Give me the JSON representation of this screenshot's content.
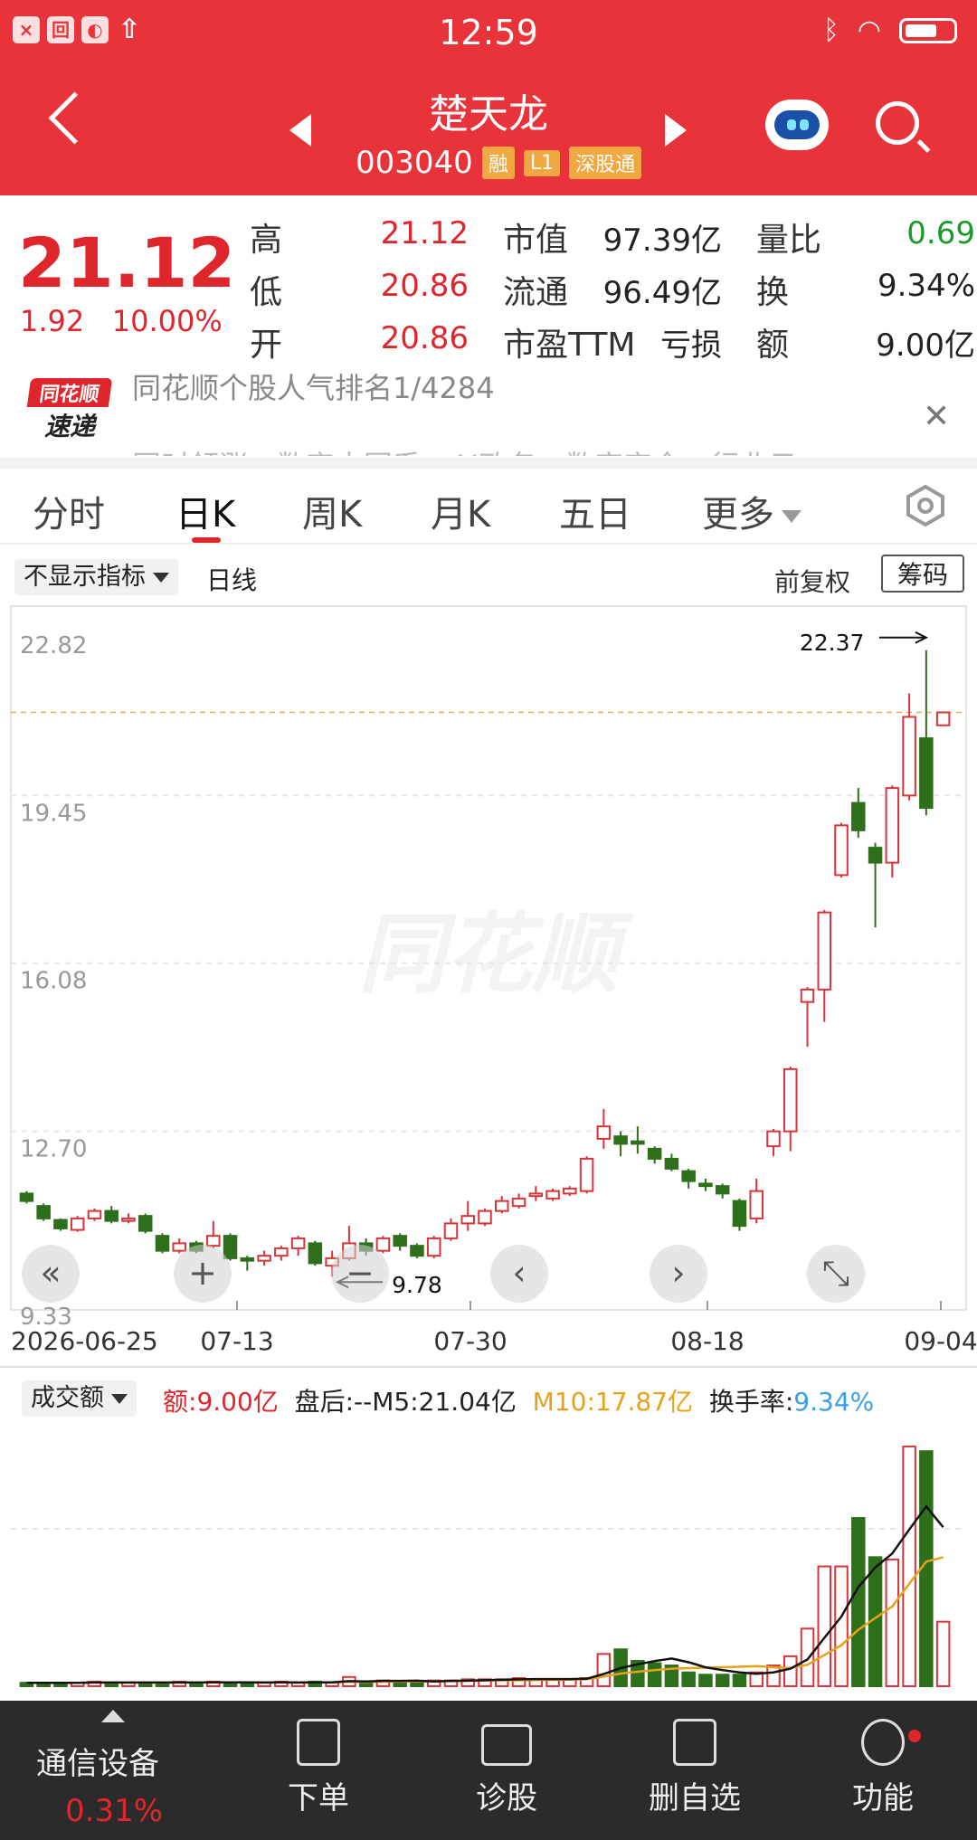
{
  "status_bar": {
    "time": "12:59"
  },
  "header": {
    "stock_name": "楚天龙",
    "code": "003040",
    "tags": [
      "融",
      "L1",
      "深股通"
    ]
  },
  "quote": {
    "price": "21.12",
    "change": "1.92",
    "change_pct": "10.00%",
    "rows": [
      [
        {
          "label": "高",
          "value": "21.12",
          "color": "red"
        },
        {
          "label": "市值",
          "value": "97.39亿",
          "color": "dark"
        },
        {
          "label": "量比",
          "value": "0.69",
          "color": "green"
        }
      ],
      [
        {
          "label": "低",
          "value": "20.86",
          "color": "red"
        },
        {
          "label": "流通",
          "value": "96.49亿",
          "color": "dark"
        },
        {
          "label": "换",
          "value": "9.34%",
          "color": "dark"
        }
      ],
      [
        {
          "label": "开",
          "value": "20.86",
          "color": "red"
        },
        {
          "label": "市盈TTM",
          "value": "亏损",
          "color": "dark"
        },
        {
          "label": "额",
          "value": "9.00亿",
          "color": "dark"
        }
      ]
    ]
  },
  "banner": {
    "logo_top": "同花顺",
    "logo_bottom": "速递",
    "line1": "同花顺个股人气排名1/4284",
    "line2": "同时领涨：数字中国系、AI政务、数字安全、行业云"
  },
  "tabs": [
    "分时",
    "日K",
    "周K",
    "月K",
    "五日",
    "更多"
  ],
  "active_tab": "日K",
  "indicator_bar": {
    "indicator": "不显示指标",
    "period": "日线",
    "adjust": "前复权",
    "chips": "筹码"
  },
  "chart_data": {
    "type": "candlestick",
    "y_ticks": [
      "22.82",
      "19.45",
      "16.08",
      "12.70",
      "9.33"
    ],
    "ylim": [
      9.33,
      22.82
    ],
    "x_ticks": [
      "2026-06-25",
      "07-13",
      "07-30",
      "08-18",
      "09-04"
    ],
    "high_label": "22.37",
    "low_label": "9.78",
    "current_price": 21.12,
    "candles": [
      {
        "o": 11.45,
        "c": 11.3,
        "h": 11.5,
        "l": 11.25
      },
      {
        "o": 11.2,
        "c": 10.95,
        "h": 11.25,
        "l": 10.9
      },
      {
        "o": 10.92,
        "c": 10.75,
        "h": 10.95,
        "l": 10.7
      },
      {
        "o": 10.72,
        "c": 10.95,
        "h": 11.0,
        "l": 10.68
      },
      {
        "o": 10.95,
        "c": 11.1,
        "h": 11.15,
        "l": 10.9
      },
      {
        "o": 11.1,
        "c": 10.9,
        "h": 11.2,
        "l": 10.85
      },
      {
        "o": 10.9,
        "c": 10.95,
        "h": 11.05,
        "l": 10.85
      },
      {
        "o": 11.0,
        "c": 10.7,
        "h": 11.05,
        "l": 10.65
      },
      {
        "o": 10.6,
        "c": 10.3,
        "h": 10.65,
        "l": 10.25
      },
      {
        "o": 10.3,
        "c": 10.45,
        "h": 10.55,
        "l": 10.25
      },
      {
        "o": 10.45,
        "c": 10.3,
        "h": 10.5,
        "l": 10.25
      },
      {
        "o": 10.4,
        "c": 10.6,
        "h": 10.9,
        "l": 10.35
      },
      {
        "o": 10.6,
        "c": 10.15,
        "h": 10.65,
        "l": 10.1
      },
      {
        "o": 10.15,
        "c": 10.1,
        "h": 10.2,
        "l": 9.9
      },
      {
        "o": 10.1,
        "c": 10.2,
        "h": 10.3,
        "l": 10.0
      },
      {
        "o": 10.2,
        "c": 10.35,
        "h": 10.4,
        "l": 10.1
      },
      {
        "o": 10.35,
        "c": 10.55,
        "h": 10.6,
        "l": 10.2
      },
      {
        "o": 10.45,
        "c": 10.05,
        "h": 10.5,
        "l": 10.0
      },
      {
        "o": 10.0,
        "c": 10.15,
        "h": 10.3,
        "l": 9.78
      },
      {
        "o": 10.15,
        "c": 10.45,
        "h": 10.8,
        "l": 10.1
      },
      {
        "o": 10.45,
        "c": 10.3,
        "h": 10.55,
        "l": 10.2
      },
      {
        "o": 10.3,
        "c": 10.55,
        "h": 10.6,
        "l": 10.25
      },
      {
        "o": 10.6,
        "c": 10.4,
        "h": 10.65,
        "l": 10.3
      },
      {
        "o": 10.4,
        "c": 10.2,
        "h": 10.45,
        "l": 10.15
      },
      {
        "o": 10.2,
        "c": 10.55,
        "h": 10.6,
        "l": 10.15
      },
      {
        "o": 10.55,
        "c": 10.85,
        "h": 10.95,
        "l": 10.5
      },
      {
        "o": 10.85,
        "c": 11.0,
        "h": 11.3,
        "l": 10.7
      },
      {
        "o": 10.85,
        "c": 11.1,
        "h": 11.15,
        "l": 10.8
      },
      {
        "o": 11.1,
        "c": 11.3,
        "h": 11.4,
        "l": 11.05
      },
      {
        "o": 11.2,
        "c": 11.35,
        "h": 11.45,
        "l": 11.15
      },
      {
        "o": 11.4,
        "c": 11.45,
        "h": 11.6,
        "l": 11.3
      },
      {
        "o": 11.35,
        "c": 11.5,
        "h": 11.55,
        "l": 11.3
      },
      {
        "o": 11.45,
        "c": 11.55,
        "h": 11.6,
        "l": 11.4
      },
      {
        "o": 11.5,
        "c": 12.15,
        "h": 12.2,
        "l": 11.45
      },
      {
        "o": 12.55,
        "c": 12.8,
        "h": 13.15,
        "l": 12.35
      },
      {
        "o": 12.6,
        "c": 12.45,
        "h": 12.7,
        "l": 12.2
      },
      {
        "o": 12.5,
        "c": 12.45,
        "h": 12.8,
        "l": 12.25
      },
      {
        "o": 12.35,
        "c": 12.15,
        "h": 12.4,
        "l": 12.05
      },
      {
        "o": 12.15,
        "c": 11.95,
        "h": 12.25,
        "l": 11.9
      },
      {
        "o": 11.9,
        "c": 11.7,
        "h": 11.95,
        "l": 11.55
      },
      {
        "o": 11.65,
        "c": 11.6,
        "h": 11.75,
        "l": 11.5
      },
      {
        "o": 11.6,
        "c": 11.45,
        "h": 11.65,
        "l": 11.35
      },
      {
        "o": 11.3,
        "c": 10.8,
        "h": 11.35,
        "l": 10.7
      },
      {
        "o": 10.95,
        "c": 11.5,
        "h": 11.75,
        "l": 10.85
      },
      {
        "o": 12.4,
        "c": 12.7,
        "h": 12.75,
        "l": 12.2
      },
      {
        "o": 12.7,
        "c": 13.95,
        "h": 14.0,
        "l": 12.3
      },
      {
        "o": 15.3,
        "c": 15.55,
        "h": 15.6,
        "l": 14.4
      },
      {
        "o": 15.55,
        "c": 17.1,
        "h": 17.15,
        "l": 14.9
      },
      {
        "o": 17.85,
        "c": 18.85,
        "h": 18.9,
        "l": 17.8
      },
      {
        "o": 19.3,
        "c": 18.75,
        "h": 19.6,
        "l": 18.6
      },
      {
        "o": 18.4,
        "c": 18.1,
        "h": 18.5,
        "l": 16.8
      },
      {
        "o": 18.1,
        "c": 19.6,
        "h": 19.65,
        "l": 17.8
      },
      {
        "o": 19.45,
        "c": 21.03,
        "h": 21.5,
        "l": 19.35
      },
      {
        "o": 20.6,
        "c": 19.2,
        "h": 22.37,
        "l": 19.05
      },
      {
        "o": 20.86,
        "c": 21.12,
        "h": 21.12,
        "l": 20.86
      }
    ]
  },
  "volume": {
    "selector": "成交额",
    "amount_label": "额:",
    "amount": "9.00亿",
    "after_label": "盘后:--",
    "m5": "M5:21.04亿",
    "m10": "M10:17.87亿",
    "turnover_label": "换手率:",
    "turnover": "9.34%",
    "bars": [
      0.15,
      0.15,
      0.15,
      0.15,
      0.2,
      0.15,
      0.15,
      0.15,
      0.15,
      0.2,
      0.15,
      0.2,
      0.15,
      0.15,
      0.15,
      0.2,
      0.15,
      0.2,
      0.15,
      0.4,
      0.15,
      0.25,
      0.2,
      0.2,
      0.25,
      0.25,
      0.3,
      0.3,
      0.3,
      0.35,
      0.3,
      0.3,
      0.3,
      0.35,
      1.4,
      1.6,
      1.1,
      1.0,
      0.9,
      0.6,
      0.5,
      0.5,
      0.5,
      0.6,
      0.9,
      1.3,
      2.5,
      5.2,
      5.2,
      7.3,
      5.6,
      5.5,
      10.4,
      10.2,
      2.8
    ]
  },
  "bottom_bar": {
    "sector": "通信设备",
    "sector_change": "0.31%",
    "items": [
      "下单",
      "诊股",
      "删自选",
      "功能"
    ]
  }
}
